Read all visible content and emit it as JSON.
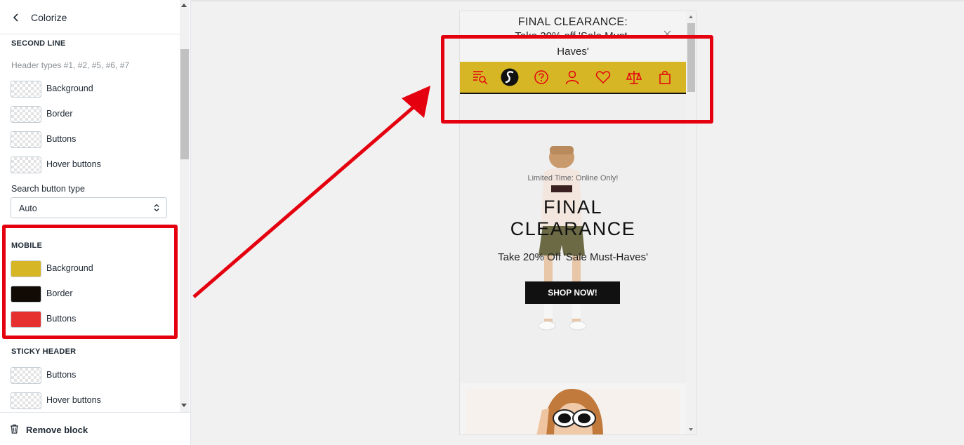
{
  "panel": {
    "title": "Colorize",
    "second_line": {
      "title": "SECOND LINE",
      "subtitle": "Header types #1, #2, #5, #6, #7",
      "swatches": [
        {
          "label": "Background",
          "color": "transparent"
        },
        {
          "label": "Border",
          "color": "transparent"
        },
        {
          "label": "Buttons",
          "color": "transparent"
        },
        {
          "label": "Hover buttons",
          "color": "transparent"
        }
      ],
      "search_button_type": {
        "label": "Search button type",
        "value": "Auto"
      }
    },
    "mobile": {
      "title": "MOBILE",
      "swatches": [
        {
          "label": "Background",
          "color": "#d6b624"
        },
        {
          "label": "Border",
          "color": "#110a05"
        },
        {
          "label": "Buttons",
          "color": "#e63030"
        }
      ]
    },
    "sticky_header": {
      "title": "STICKY HEADER",
      "swatches": [
        {
          "label": "Buttons",
          "color": "transparent"
        },
        {
          "label": "Hover buttons",
          "color": "transparent"
        }
      ]
    },
    "footer": {
      "remove_label": "Remove block"
    }
  },
  "preview": {
    "announcement": {
      "line1": "FINAL CLEARANCE:",
      "line2": "Take 20% off 'Sale Must-",
      "line3": "Haves'"
    },
    "header": {
      "background": "#d6b624",
      "icon_color": "#e4000f",
      "icons": [
        "menu-search-icon",
        "logo-icon",
        "help-icon",
        "account-icon",
        "wishlist-icon",
        "compare-icon",
        "cart-icon"
      ]
    },
    "hero": {
      "kicker": "Limited Time: Online Only!",
      "title_line1": "FINAL",
      "title_line2": "CLEARANCE",
      "subtitle": "Take 20% Off 'Sale Must-Haves'",
      "button": "SHOP NOW!"
    }
  },
  "annotation": {
    "color": "#e4000f"
  }
}
